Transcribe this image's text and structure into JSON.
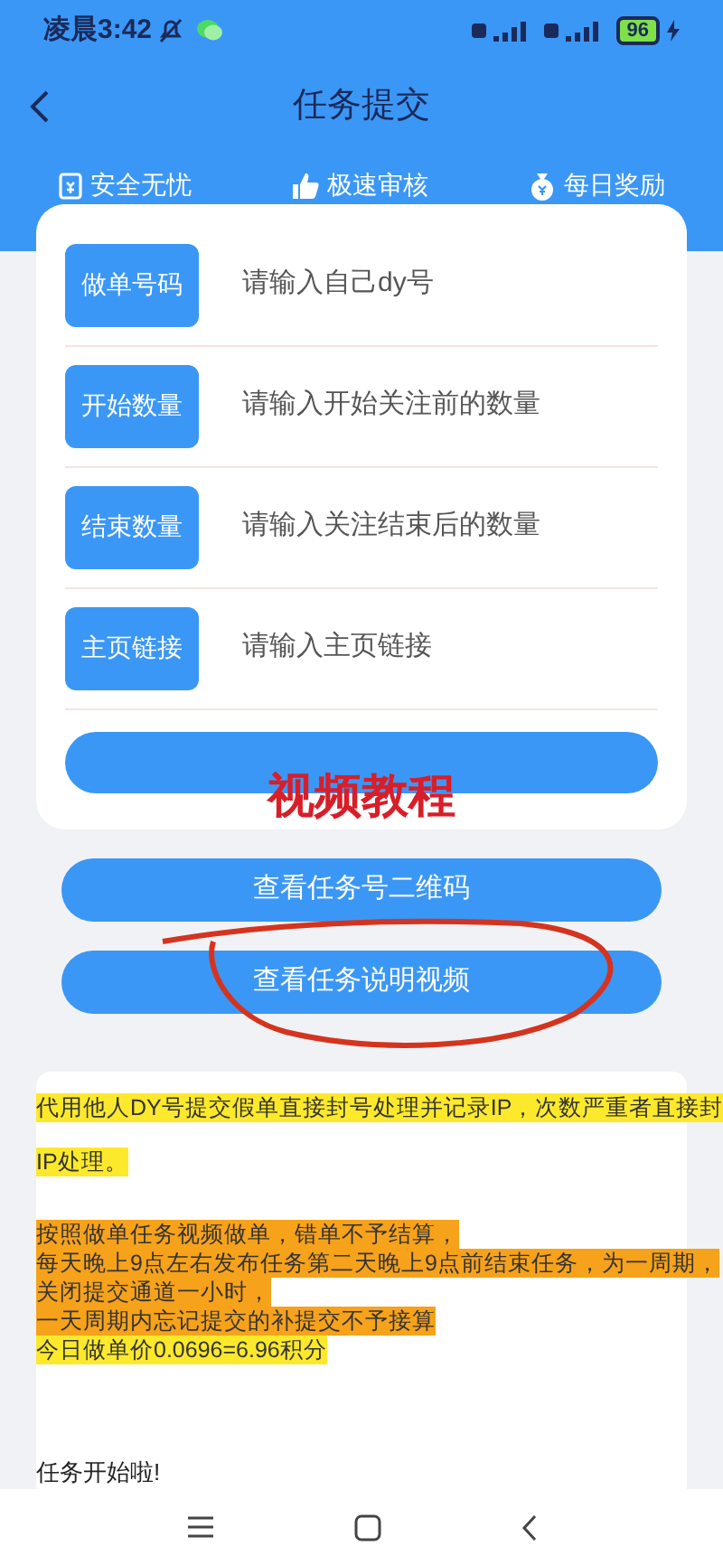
{
  "status_bar": {
    "time": "凌晨3:42",
    "battery": "96"
  },
  "header": {
    "title": "任务提交"
  },
  "features": [
    {
      "kind": "shield",
      "label": "安全无忧"
    },
    {
      "kind": "thumb",
      "label": "极速审核"
    },
    {
      "kind": "bag",
      "label": "每日奖励"
    }
  ],
  "form": [
    {
      "label": "做单号码",
      "placeholder": "请输入自己dy号"
    },
    {
      "label": "开始数量",
      "placeholder": "请输入开始关注前的数量"
    },
    {
      "label": "结束数量",
      "placeholder": "请输入关注结束后的数量"
    },
    {
      "label": "主页链接",
      "placeholder": "请输入主页链接"
    }
  ],
  "overlay_caption": "视频教程",
  "buttons": [
    "查看任务号二维码",
    "查看任务说明视频"
  ],
  "notice": {
    "groups": [
      {
        "spaced": true,
        "lines": [
          {
            "text": "代用他人DY号提交假单直接封号处理并记录IP，次数严重者直接封",
            "color": "#fde92b"
          },
          {
            "text": "IP处理。",
            "color": "#fde92b"
          }
        ]
      },
      {
        "spaced": false,
        "lines": [
          {
            "text": "按照做单任务视频做单，错单不予结算，",
            "color": "#f7a21b"
          },
          {
            "text": "每天晚上9点左右发布任务第二天晚上9点前结束任务，为一周期，",
            "color": "#f7a21b"
          },
          {
            "text": "关闭提交通道一小时，",
            "color": "#f7a21b"
          },
          {
            "text": "一天周期内忘记提交的补提交不予接算",
            "color": "#f7a21b"
          },
          {
            "text": "今日做单价0.0696=6.96积分",
            "color": "#fde92b"
          }
        ]
      }
    ],
    "footer": "任务开始啦!"
  }
}
